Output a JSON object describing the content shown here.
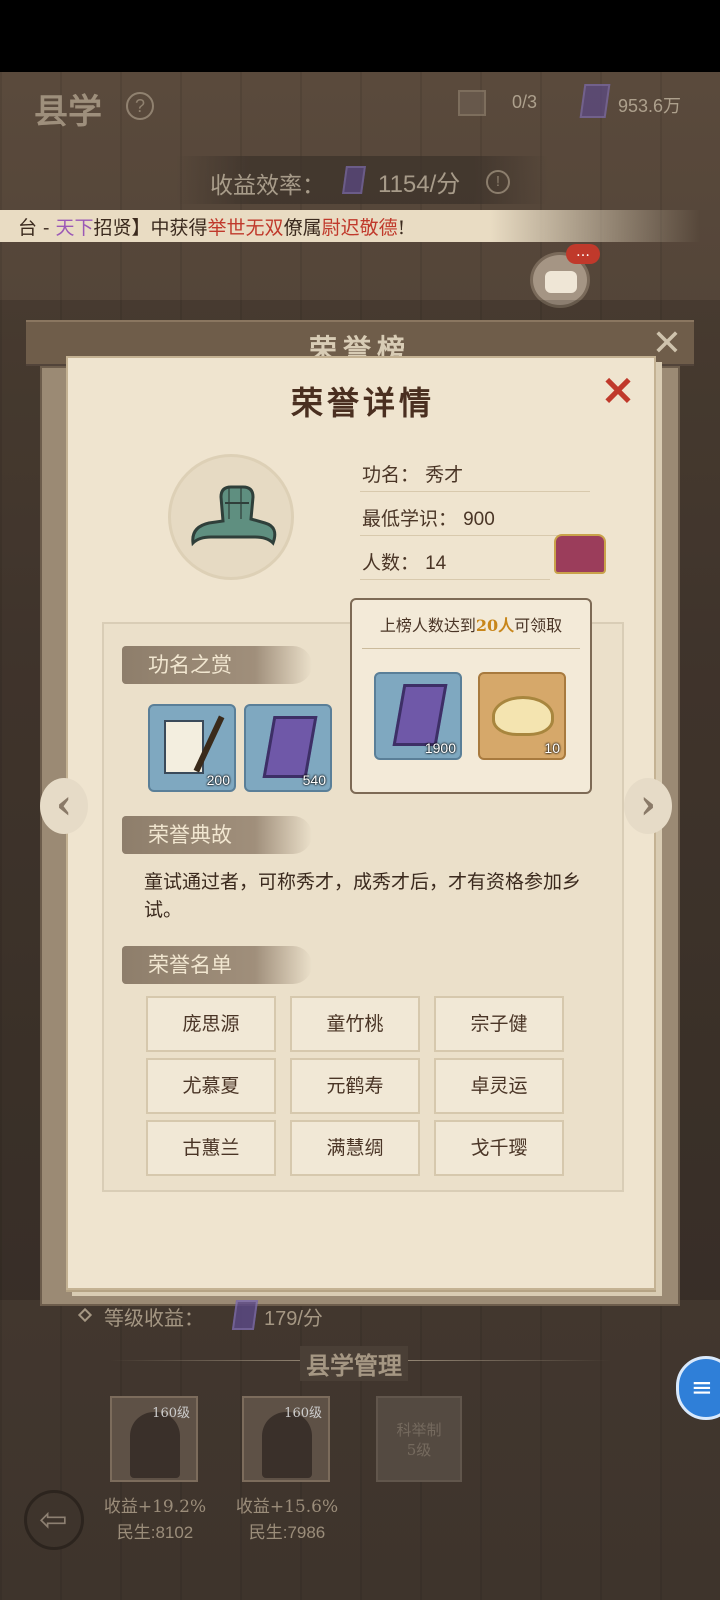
{
  "header": {
    "title": "县学",
    "slot_count": "0/3",
    "book_total": "953.6万",
    "efficiency_label": "收益效率：",
    "efficiency_value": "1154/分"
  },
  "marquee": {
    "p1": "台 - ",
    "p2": "天下",
    "p3": "招贤",
    "p4": "】中获得",
    "p5": "举世无双",
    "p6": "僚属",
    "p7": "尉迟敬德",
    "p8": "!"
  },
  "chat_badge": "…",
  "board": {
    "title": "荣誉榜",
    "close": "✕"
  },
  "detail": {
    "title": "荣誉详情",
    "close": "✕",
    "rank_label": "功名：",
    "rank_value": "秀才",
    "min_knowledge_label": "最低学识：",
    "min_knowledge_value": "900",
    "count_label": "人数：",
    "count_value": "14",
    "reward_note_prefix": "上榜人数达到",
    "reward_note_highlight": "20人",
    "reward_note_suffix": "可领取",
    "group_rewards": [
      {
        "icon": "purple-book-icon",
        "count": "1900"
      },
      {
        "icon": "gold-ingot-icon",
        "count": "10"
      }
    ],
    "section_rank_reward": "功名之赏",
    "rank_rewards": [
      {
        "icon": "calligraphy-scroll-icon",
        "count": "200"
      },
      {
        "icon": "purple-book-icon",
        "count": "540"
      }
    ],
    "section_story": "荣誉典故",
    "story_text": "童试通过者，可称秀才，成秀才后，才有资格参加乡试。",
    "section_roster": "荣誉名单",
    "roster": [
      "庞思源",
      "童竹桃",
      "宗子健",
      "尤慕夏",
      "元鹤寿",
      "卓灵运",
      "古蕙兰",
      "满慧绸",
      "戈千璎"
    ],
    "nav_left": "‹",
    "nav_right": "›"
  },
  "bottom": {
    "level_income_label": "等级收益：",
    "level_income_value": "179/分",
    "management_title": "县学管理",
    "heroes": [
      {
        "level": "160级",
        "income": "收益+19.2%",
        "people": "民生:8102"
      },
      {
        "level": "160级",
        "income": "收益+15.6%",
        "people": "民生:7986"
      }
    ],
    "locked_slot_line1": "科举制",
    "locked_slot_line2": "5级",
    "back_icon": "back-arrow-icon"
  },
  "colors": {
    "paper": "#efe4cf",
    "accent_red": "#c0392b",
    "highlight_gold": "#c8861a",
    "name_purple": "#9b59b6",
    "name_red": "#c0392b"
  }
}
